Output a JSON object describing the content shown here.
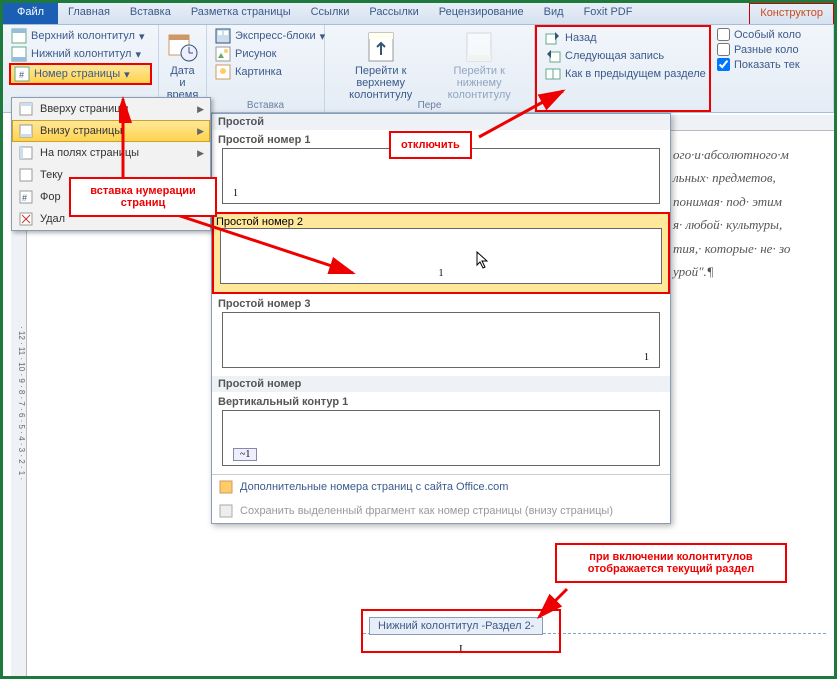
{
  "tabs": {
    "file": "Файл",
    "home": "Главная",
    "insert": "Вставка",
    "layout": "Разметка страницы",
    "refs": "Ссылки",
    "mail": "Рассылки",
    "review": "Рецензирование",
    "view": "Вид",
    "foxit": "Foxit PDF",
    "design": "Конструктор"
  },
  "ribbon": {
    "header": "Верхний колонтитул",
    "footer": "Нижний колонтитул",
    "pagenum": "Номер страницы",
    "datetime": "Дата и время",
    "express": "Экспресс-блоки",
    "picture": "Рисунок",
    "clipart": "Картинка",
    "insert_group": "Вставка",
    "goto_header": "Перейти к верхнему колонтитулу",
    "goto_footer": "Перейти к нижнему колонтитулу",
    "nav_group": "Пере",
    "back": "Назад",
    "next": "Следующая запись",
    "link_prev": "Как в предыдущем разделе",
    "special_first": "Особый коло",
    "diff_pages": "Разные коло",
    "show_text": "Показать тек"
  },
  "menu": {
    "top": "Вверху страницы",
    "bottom": "Внизу страницы",
    "margins": "На полях страницы",
    "current": "Теку",
    "format": "Фор",
    "remove": "Удал"
  },
  "gallery": {
    "simple_head": "Простой",
    "item1": "Простой номер 1",
    "item2": "Простой номер 2",
    "item3": "Простой номер 3",
    "contour_head": "Простой номер",
    "item4": "Вертикальный контур 1",
    "more": "Дополнительные номера страниц с сайта Office.com",
    "save": "Сохранить выделенный фрагмент как номер страницы (внизу страницы)"
  },
  "callouts": {
    "insert_num": "вставка нумерации страниц",
    "disable": "отключить",
    "footer_section": "при включении колонтитулов отображается текущий раздел"
  },
  "footer_tag": "Нижний колонтитул -Раздел 2-",
  "doc_lines": [
    "ого·и·абсолютного·м",
    "льных· предметов,",
    "понимая· под· этим",
    "я· любой· культуры,",
    "тия,· которые· не· зо",
    "урой\".¶"
  ],
  "ruler_v": "· 12 · 11 · 10 · 9 · 8 · 7 · 6 · 5 · 4 · 3 · 2 · 1 ·"
}
